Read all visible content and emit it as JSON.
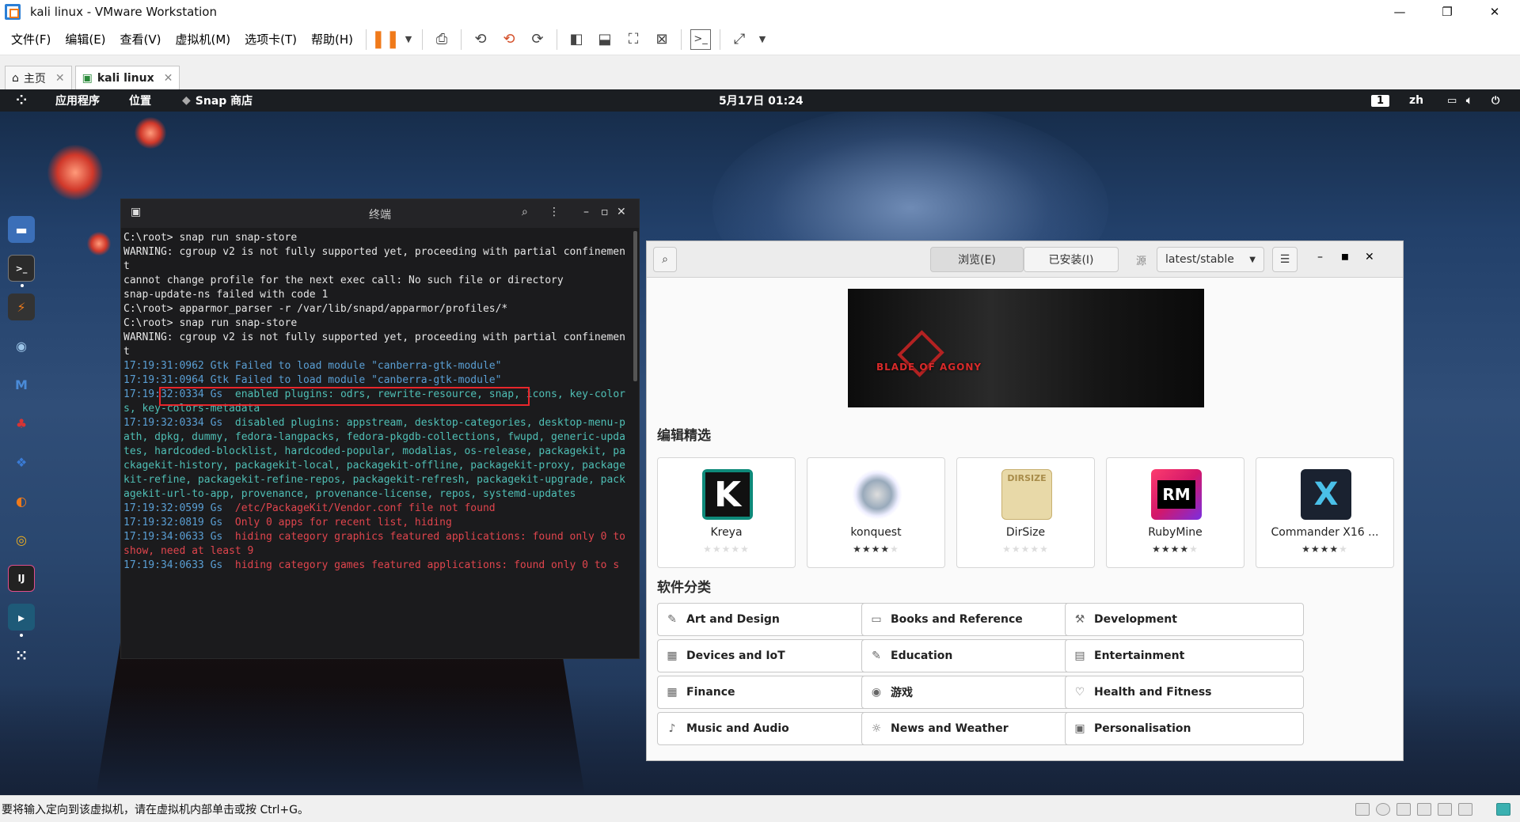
{
  "window": {
    "title": "kali linux - VMware Workstation",
    "minimize": "—",
    "restore": "❐",
    "close": "✕"
  },
  "menu": [
    "文件(F)",
    "编辑(E)",
    "查看(V)",
    "虚拟机(M)",
    "选项卡(T)",
    "帮助(H)"
  ],
  "tabs": [
    {
      "label": "主页"
    },
    {
      "label": "kali linux"
    }
  ],
  "gnome": {
    "apps": "应用程序",
    "places": "位置",
    "snap": "Snap 商店",
    "clock": "5月17日 01:24",
    "workspace": "1",
    "lang": "zh"
  },
  "terminal": {
    "title": "终端",
    "lines": [
      [
        {
          "t": "C:\\root> snap run snap-store",
          "c": ""
        }
      ],
      [
        {
          "t": "WARNING: cgroup v2 is not fully supported yet, proceeding with partial confinement",
          "c": ""
        }
      ],
      [
        {
          "t": "cannot change profile for the next exec call: No such file or directory",
          "c": ""
        }
      ],
      [
        {
          "t": "snap-update-ns failed with code 1",
          "c": ""
        }
      ],
      [
        {
          "t": "C:\\root> apparmor_parser -r /var/lib/snapd/apparmor/profiles/*",
          "c": ""
        }
      ],
      [
        {
          "t": "C:\\root> snap run snap-store",
          "c": ""
        }
      ],
      [
        {
          "t": "WARNING: cgroup v2 is not fully supported yet, proceeding with partial confinement",
          "c": ""
        }
      ],
      [
        {
          "t": "17:19:31:0962 Gtk ",
          "c": "ts"
        },
        {
          "t": "Failed to load module \"canberra-gtk-module\"",
          "c": "ts"
        }
      ],
      [
        {
          "t": "17:19:31:0964 Gtk ",
          "c": "ts"
        },
        {
          "t": "Failed to load module \"canberra-gtk-module\"",
          "c": "ts"
        }
      ],
      [
        {
          "t": "17:19:32:0334 Gs  ",
          "c": "ts"
        },
        {
          "t": "enabled plugins: odrs, rewrite-resource, snap, icons, key-colors, key-colors-metadata",
          "c": "tg"
        }
      ],
      [
        {
          "t": "17:19:32:0334 Gs  ",
          "c": "ts"
        },
        {
          "t": "disabled plugins: appstream, desktop-categories, desktop-menu-path, dpkg, dummy, fedora-langpacks, fedora-pkgdb-collections, fwupd, generic-updates, hardcoded-blocklist, hardcoded-popular, modalias, os-release, packagekit, packagekit-history, packagekit-local, packagekit-offline, packagekit-proxy, packagekit-refine, packagekit-refine-repos, packagekit-refresh, packagekit-upgrade, packagekit-url-to-app, provenance, provenance-license, repos, systemd-updates",
          "c": "tg"
        }
      ],
      [
        {
          "t": "17:19:32:0599 Gs  ",
          "c": "ts"
        },
        {
          "t": "/etc/PackageKit/Vendor.conf file not found",
          "c": "tr"
        }
      ],
      [
        {
          "t": "17:19:32:0819 Gs  ",
          "c": "ts"
        },
        {
          "t": "Only 0 apps for recent list, hiding",
          "c": "tr"
        }
      ],
      [
        {
          "t": "17:19:34:0633 Gs  ",
          "c": "ts"
        },
        {
          "t": "hiding category graphics featured applications: found only 0 to show, need at least 9",
          "c": "tr"
        }
      ],
      [
        {
          "t": "17:19:34:0633 Gs  ",
          "c": "ts"
        },
        {
          "t": "hiding category games featured applications: found only 0 to s",
          "c": "tr"
        }
      ]
    ]
  },
  "snap": {
    "browse": "浏览(E)",
    "installed": "已安装(I)",
    "source_label": "源",
    "channel": "latest/stable",
    "banner_title": "BLADE OF AGONY",
    "editors_picks": "编辑精选",
    "categories_title": "软件分类",
    "apps": [
      {
        "name": "Kreya",
        "rating": 0,
        "icon_text": "K"
      },
      {
        "name": "konquest",
        "rating": 4,
        "icon_text": ""
      },
      {
        "name": "DirSize",
        "rating": 0,
        "icon_text": "DIRSIZE"
      },
      {
        "name": "RubyMine",
        "rating": 4,
        "icon_text": "RM"
      },
      {
        "name": "Commander X16 ...",
        "rating": 4,
        "icon_text": "X"
      }
    ],
    "categories": [
      {
        "label": "Art and Design",
        "icon": "✎"
      },
      {
        "label": "Books and Reference",
        "icon": "▭"
      },
      {
        "label": "Development",
        "icon": "⚒"
      },
      {
        "label": "Devices and IoT",
        "icon": "▦"
      },
      {
        "label": "Education",
        "icon": "✎"
      },
      {
        "label": "Entertainment",
        "icon": "▤"
      },
      {
        "label": "Finance",
        "icon": "▦"
      },
      {
        "label": "游戏",
        "icon": "◉"
      },
      {
        "label": "Health and Fitness",
        "icon": "♡"
      },
      {
        "label": "Music and Audio",
        "icon": "♪"
      },
      {
        "label": "News and Weather",
        "icon": "☼"
      },
      {
        "label": "Personalisation",
        "icon": "▣"
      }
    ]
  },
  "status": {
    "text": "要将输入定向到该虚拟机，请在虚拟机内部单击或按 Ctrl+G。"
  }
}
